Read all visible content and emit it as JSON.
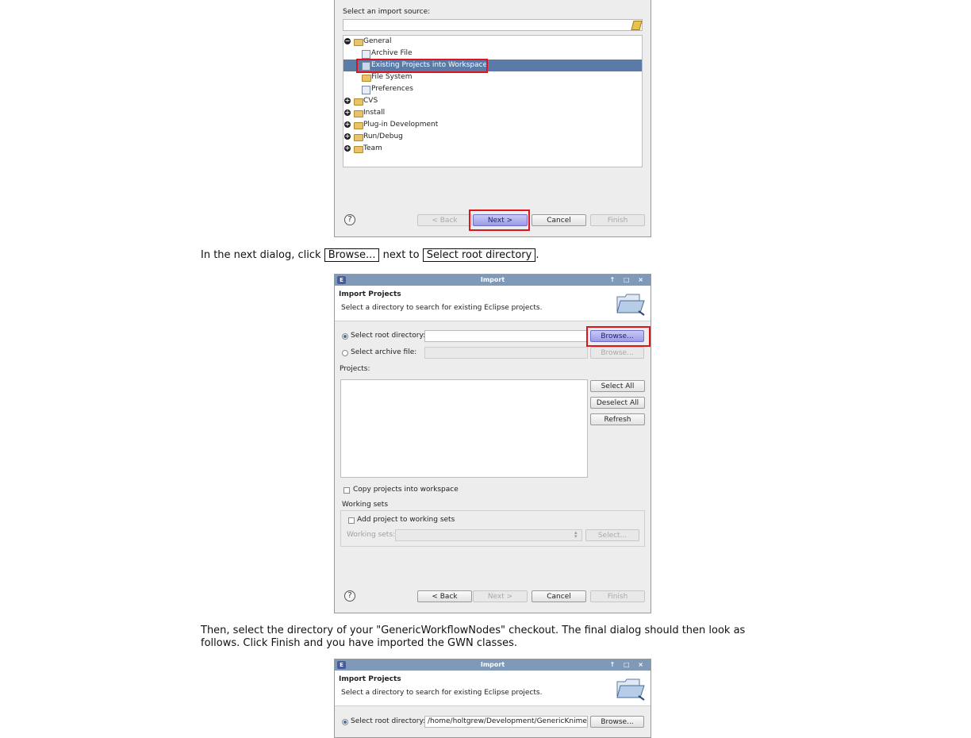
{
  "dialog1": {
    "select_source_label": "Select an import source:",
    "tree": [
      {
        "label": "General",
        "expanded": true
      },
      {
        "label": "Archive File"
      },
      {
        "label": "Existing Projects into Workspace",
        "selected": true
      },
      {
        "label": "File System"
      },
      {
        "label": "Preferences"
      },
      {
        "label": "CVS"
      },
      {
        "label": "Install"
      },
      {
        "label": "Plug-in Development"
      },
      {
        "label": "Run/Debug"
      },
      {
        "label": "Team"
      }
    ],
    "buttons": {
      "back": "< Back",
      "next": "Next >",
      "cancel": "Cancel",
      "finish": "Finish"
    },
    "help": "?"
  },
  "para1": {
    "before": "In the next dialog, click",
    "browse": "Browse...",
    "middle": "next to",
    "root": "Select root directory",
    "after": "."
  },
  "dialog2": {
    "title": "Import",
    "window_controls": "↑ □ ×",
    "heading": "Import Projects",
    "subheading": "Select a directory to search for existing Eclipse projects.",
    "root_label": "Select root directory:",
    "archive_label": "Select archive file:",
    "browse": "Browse...",
    "projects_label": "Projects:",
    "select_all": "Select All",
    "deselect_all": "Deselect All",
    "refresh": "Refresh",
    "copy_label": "Copy projects into workspace",
    "working_sets_group": "Working sets",
    "add_ws_label": "Add project to working sets",
    "ws_label": "Working sets:",
    "ws_select": "Select...",
    "buttons": {
      "back": "< Back",
      "next": "Next >",
      "cancel": "Cancel",
      "finish": "Finish"
    },
    "help": "?"
  },
  "para2": {
    "text": "Then, select the directory of your \"GenericWorkflowNodes\" checkout. The final dialog should then look as follows. Click Finish and you have imported the GWN classes."
  },
  "dialog3": {
    "title": "Import",
    "window_controls": "↑ □ ×",
    "heading": "Import Projects",
    "subheading": "Select a directory to search for existing Eclipse projects.",
    "root_label": "Select root directory:",
    "root_value": "/home/holtgrew/Development/GenericKnimeNodes",
    "browse": "Browse..."
  },
  "colors": {
    "highlight_red": "#e0141c",
    "selection_blue": "#5a7ba8",
    "titlebar": "#7e9ab8",
    "primary_button": "#9b9be6"
  }
}
